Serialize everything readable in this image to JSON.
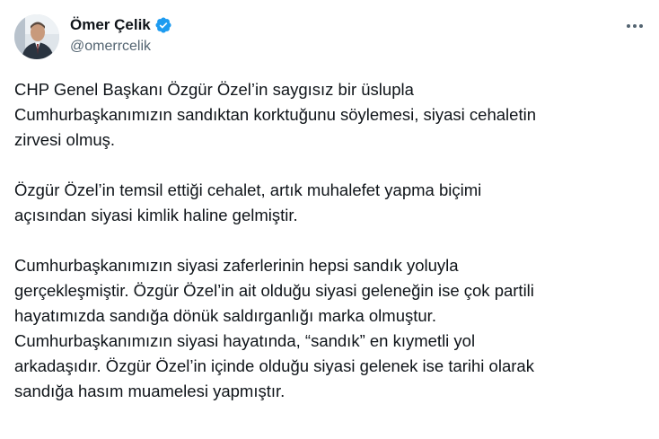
{
  "author": {
    "display_name": "Ömer Çelik",
    "handle": "@omerrcelik",
    "verified": true,
    "verified_color": "#1d9bf0"
  },
  "icons": {
    "avatar": "profile-photo",
    "verified": "verified-badge-icon",
    "more": "more-horizontal-icon"
  },
  "tweet": {
    "paragraphs": [
      {
        "lines": [
          "CHP Genel Başkanı Özgür Özel’in saygısız bir üslupla",
          "Cumhurbaşkanımızın sandıktan korktuğunu söylemesi, siyasi cehaletin",
          "zirvesi olmuş."
        ]
      },
      {
        "lines": [
          "Özgür Özel’in temsil ettiği cehalet, artık muhalefet yapma biçimi",
          "açısından siyasi kimlik haline gelmiştir."
        ]
      },
      {
        "lines": [
          "Cumhurbaşkanımızın siyasi zaferlerinin hepsi sandık yoluyla",
          "gerçekleşmiştir. Özgür Özel’in ait olduğu siyasi geleneğin ise çok partili",
          "hayatımızda sandığa dönük saldırganlığı marka olmuştur.",
          "Cumhurbaşkanımızın siyasi hayatında, “sandık” en kıymetli yol",
          "arkadaşıdır. Özgür Özel’in içinde olduğu siyasi gelenek ise tarihi olarak",
          "sandığa hasım muamelesi yapmıştır."
        ]
      }
    ]
  }
}
